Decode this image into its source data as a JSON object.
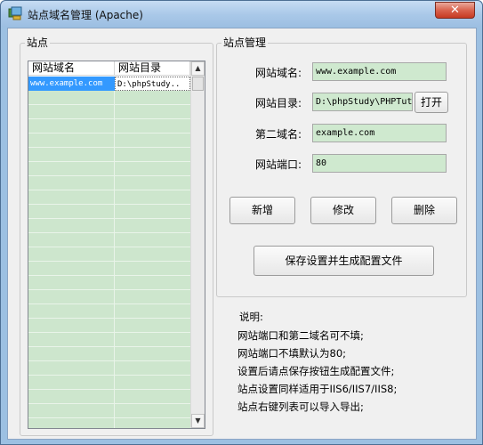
{
  "window": {
    "title": "站点域名管理 (Apache)",
    "close_label": "✕"
  },
  "sites": {
    "group_label": "站点",
    "columns": [
      "网站域名",
      "网站目录"
    ],
    "rows": [
      {
        "domain": "www.example.com",
        "directory": "D:\\phpStudy.."
      }
    ],
    "scroll_up": "▲",
    "scroll_down": "▼"
  },
  "management": {
    "group_label": "站点管理",
    "domain_label": "网站域名:",
    "domain_value": "www.example.com",
    "directory_label": "网站目录:",
    "directory_value": "D:\\phpStudy\\PHPTut",
    "open_button": "打开",
    "second_domain_label": "第二域名:",
    "second_domain_value": "example.com",
    "port_label": "网站端口:",
    "port_value": "80",
    "add_button": "新增",
    "edit_button": "修改",
    "delete_button": "删除",
    "save_button": "保存设置并生成配置文件"
  },
  "notes": {
    "heading": "说明:",
    "lines": [
      "网站端口和第二域名可不填;",
      "网站端口不填默认为80;",
      "设置后请点保存按钮生成配置文件;",
      "站点设置同样适用于IIS6/IIS7/IIS8;",
      "站点右键列表可以导入导出;"
    ]
  },
  "colors": {
    "field_green": "#cfe9cf",
    "selection_blue": "#3399ff",
    "titlebar_blue": "#a9c8e8"
  }
}
